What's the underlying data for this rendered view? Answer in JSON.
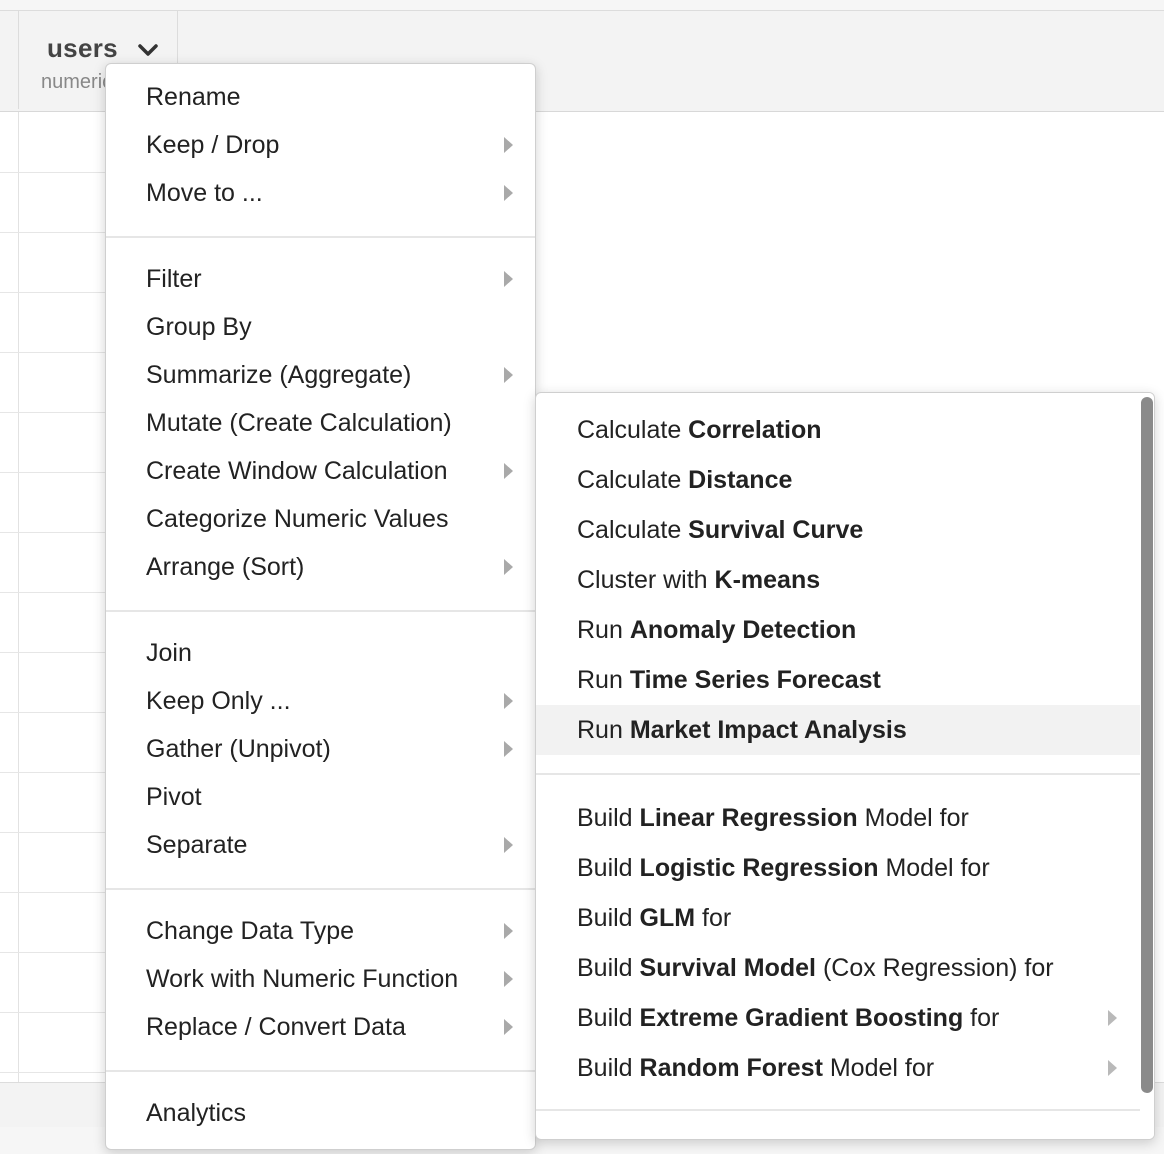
{
  "column": {
    "name": "users",
    "type": "numeric"
  },
  "main_menu": {
    "items": [
      {
        "label": "Rename",
        "submenu": false
      },
      {
        "label": "Keep / Drop",
        "submenu": true
      },
      {
        "label": "Move to ...",
        "submenu": true
      },
      {
        "label": "Filter",
        "submenu": true
      },
      {
        "label": "Group By",
        "submenu": false
      },
      {
        "label": "Summarize (Aggregate)",
        "submenu": true
      },
      {
        "label": "Mutate (Create Calculation)",
        "submenu": false
      },
      {
        "label": "Create Window Calculation",
        "submenu": true
      },
      {
        "label": "Categorize Numeric Values",
        "submenu": false
      },
      {
        "label": "Arrange (Sort)",
        "submenu": true
      },
      {
        "label": "Join",
        "submenu": false
      },
      {
        "label": "Keep Only ...",
        "submenu": true
      },
      {
        "label": "Gather (Unpivot)",
        "submenu": true
      },
      {
        "label": "Pivot",
        "submenu": false
      },
      {
        "label": "Separate",
        "submenu": true
      },
      {
        "label": "Change Data Type",
        "submenu": true
      },
      {
        "label": "Work with Numeric Function",
        "submenu": true
      },
      {
        "label": "Replace / Convert Data",
        "submenu": true
      },
      {
        "label": "Analytics",
        "submenu": true
      }
    ]
  },
  "analytics_menu": {
    "items": [
      {
        "pre": "Calculate ",
        "bold": "Correlation",
        "post": ""
      },
      {
        "pre": "Calculate ",
        "bold": "Distance",
        "post": ""
      },
      {
        "pre": "Calculate ",
        "bold": "Survival Curve",
        "post": ""
      },
      {
        "pre": "Cluster with ",
        "bold": "K-means",
        "post": ""
      },
      {
        "pre": "Run ",
        "bold": "Anomaly Detection",
        "post": ""
      },
      {
        "pre": "Run ",
        "bold": "Time Series Forecast",
        "post": ""
      },
      {
        "pre": "Run ",
        "bold": "Market Impact Analysis",
        "post": "",
        "highlighted": true
      },
      {
        "pre": "Build ",
        "bold": "Linear Regression",
        "post": " Model for"
      },
      {
        "pre": "Build ",
        "bold": "Logistic Regression",
        "post": " Model for"
      },
      {
        "pre": "Build ",
        "bold": "GLM",
        "post": " for"
      },
      {
        "pre": "Build ",
        "bold": "Survival Model",
        "post": " (Cox Regression) for"
      },
      {
        "pre": "Build ",
        "bold": "Extreme Gradient Boosting",
        "post": " for",
        "submenu": true
      },
      {
        "pre": "Build ",
        "bold": "Random Forest",
        "post": " Model for",
        "submenu": true
      }
    ]
  },
  "colors": {
    "highlight": "#f2f2f2",
    "arrow": "#a9a9a9",
    "scroll_thumb": "#8a8a8a"
  }
}
